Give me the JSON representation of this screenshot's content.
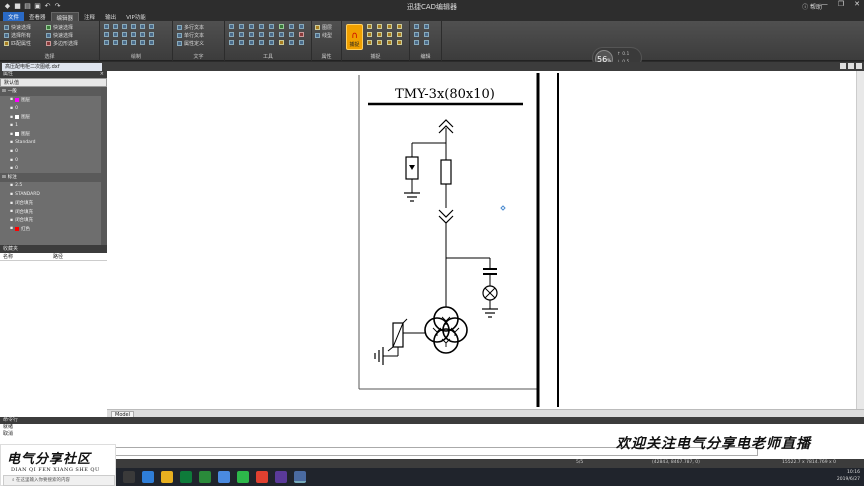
{
  "app": {
    "title": "迅捷CAD编辑器",
    "help_label": "帮助",
    "window_controls": [
      "—",
      "❐",
      "✕"
    ]
  },
  "quick_access": [
    "save-icon",
    "open-icon",
    "print-icon",
    "undo-icon",
    "redo-icon"
  ],
  "tabs": [
    "文件",
    "查看器",
    "编辑器",
    "注释",
    "输出",
    "VIP功能"
  ],
  "active_tab": "编辑器",
  "ribbon": {
    "select_group": {
      "name": "选择",
      "items": [
        "快速选择",
        "选择所有",
        "匹配属性",
        "快速选择",
        "快速选择",
        "多边形选择"
      ]
    },
    "draw_group": {
      "name": "绘制"
    },
    "text_group": {
      "name": "文字",
      "items": [
        "多行文本",
        "单行文本",
        "属性定义"
      ]
    },
    "tools_group": {
      "name": "工具"
    },
    "props_group": {
      "name": "属性",
      "items": [
        "图层",
        "线型"
      ]
    },
    "capture_group": {
      "name": "捕捉",
      "button": "捕捉"
    },
    "edit_group": {
      "name": "编辑"
    }
  },
  "status_widget": {
    "value": "56",
    "unit": "%",
    "line1": "0.1",
    "line2": "0.5"
  },
  "doc": {
    "tab": "高压配电柜二次图纸.dxf"
  },
  "left_panel": {
    "props_header": "属性",
    "default_label": "默认值",
    "tree": [
      {
        "sec": true,
        "label": "一般"
      },
      {
        "label": "图层",
        "sw": "#ff00ff"
      },
      {
        "label": "0"
      },
      {
        "label": "图层",
        "sw": "#ffffff"
      },
      {
        "label": "1"
      },
      {
        "label": "图层",
        "sw": "#ffffff"
      },
      {
        "label": "Standard"
      },
      {
        "label": "0"
      },
      {
        "label": "0"
      },
      {
        "label": "0"
      },
      {
        "sec": true,
        "label": "标注"
      },
      {
        "label": "2.5"
      },
      {
        "label": "STANDARD"
      },
      {
        "label": "闭合填充"
      },
      {
        "label": "闭合填充"
      },
      {
        "label": "闭合填充"
      },
      {
        "label": "红色",
        "sw": "#ff0000"
      }
    ],
    "fav_header": "收藏夹",
    "fav_cols": [
      "名称",
      "路径"
    ]
  },
  "drawing": {
    "label": "TMY-3x(80x10)"
  },
  "canvas": {
    "model_tab": "Model"
  },
  "command": {
    "header": "命令行",
    "lines": [
      "就绪",
      "取消"
    ],
    "input": ""
  },
  "status": {
    "page": "5/5",
    "coords": "(42843, 8467.787, 0)",
    "zoom": "15522.7 x 7814.769 x 0"
  },
  "taskbar": {
    "time": "10:16",
    "date": "2019/6/27",
    "search_placeholder": "在这里输入你要搜索的内容"
  },
  "watermark": {
    "big": "电气分享社区",
    "small": "DIAN QI FEN XIANG SHE QU"
  },
  "caption": "欢迎关注电气分享电老师直播"
}
